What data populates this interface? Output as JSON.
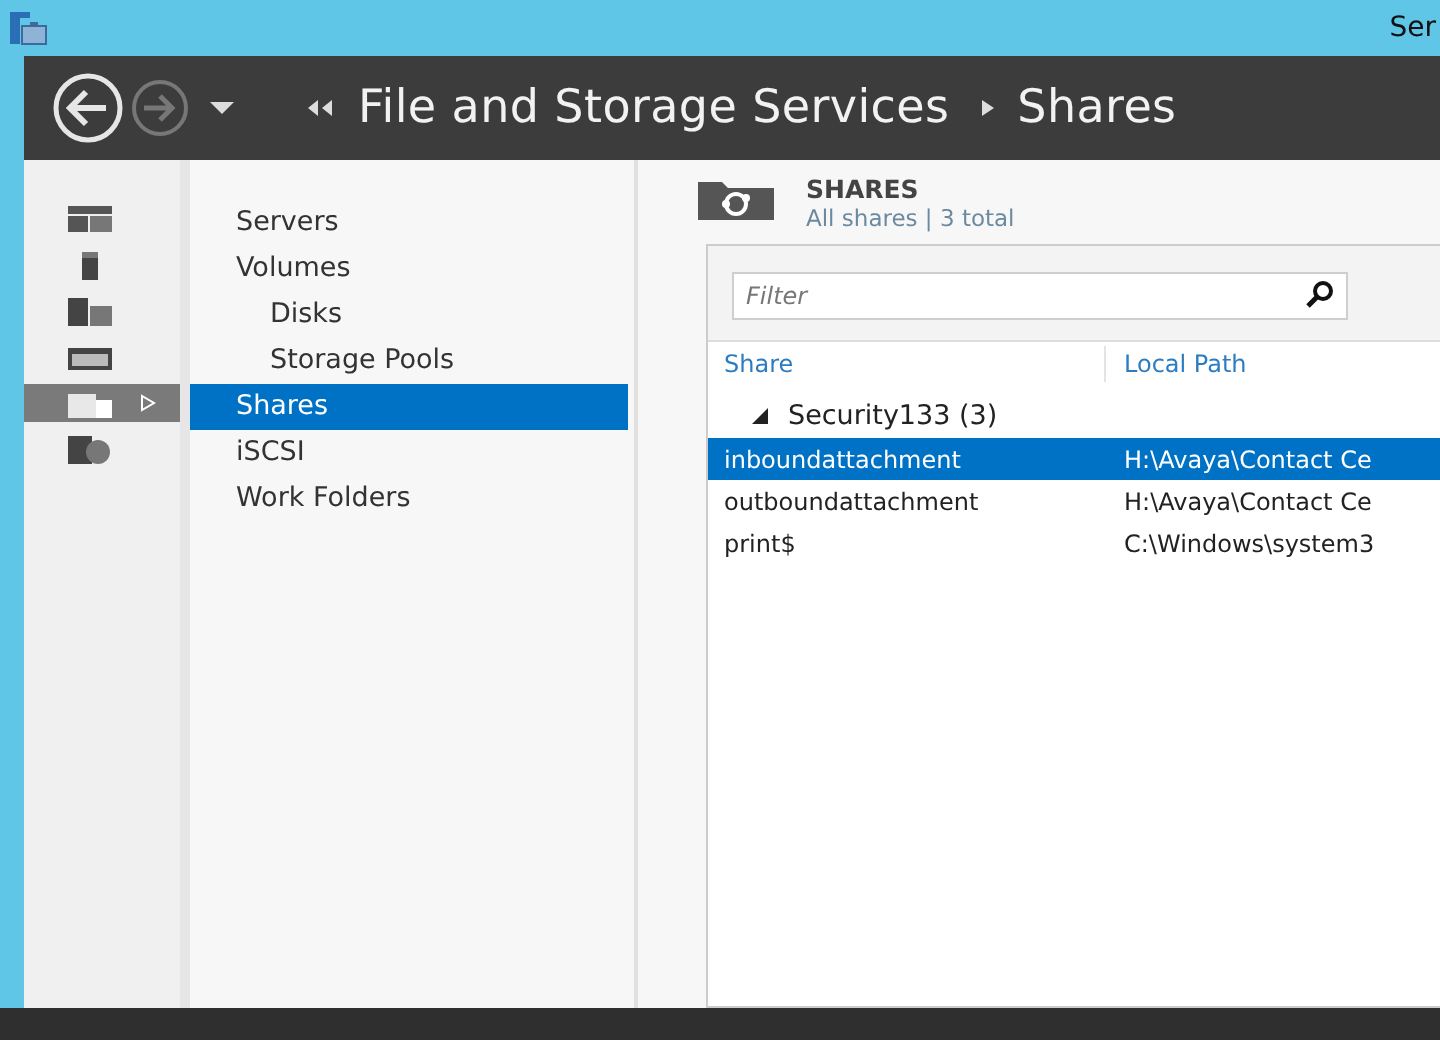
{
  "window": {
    "title": "Ser"
  },
  "header": {
    "breadcrumb": [
      {
        "kind": "back",
        "label": "File and Storage Services"
      },
      {
        "kind": "sep",
        "label": "Shares"
      }
    ]
  },
  "rail": [
    {
      "kind": "grid",
      "selected": false
    },
    {
      "kind": "server",
      "selected": false
    },
    {
      "kind": "volumes",
      "selected": false
    },
    {
      "kind": "disk",
      "selected": false
    },
    {
      "kind": "shares",
      "selected": true
    },
    {
      "kind": "iscsi",
      "selected": false
    }
  ],
  "nav": [
    {
      "label": "Servers",
      "selected": false
    },
    {
      "label": "Volumes",
      "selected": false,
      "children": [
        {
          "label": "Disks",
          "selected": false
        },
        {
          "label": "Storage Pools",
          "selected": false
        }
      ]
    },
    {
      "label": "Shares",
      "selected": true
    },
    {
      "label": "iSCSI",
      "selected": false
    },
    {
      "label": "Work Folders",
      "selected": false
    }
  ],
  "shares": {
    "title": "SHARES",
    "subtitle": "All shares | 3 total",
    "filter": {
      "placeholder": "Filter"
    },
    "columns": [
      "Share",
      "Local Path"
    ],
    "group": {
      "label": "Security133 (3)",
      "expanded": true
    },
    "rows": [
      {
        "share": "inboundattachment",
        "path": "H:\\Avaya\\Contact Ce",
        "selected": true
      },
      {
        "share": "outboundattachment",
        "path": "H:\\Avaya\\Contact Ce",
        "selected": false
      },
      {
        "share": "print$",
        "path": "C:\\Windows\\system3",
        "selected": false
      }
    ]
  }
}
